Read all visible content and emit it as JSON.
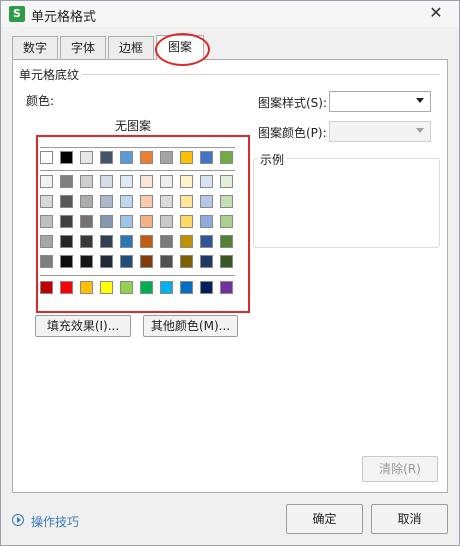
{
  "window": {
    "title": "单元格格式",
    "app_icon_text": "S",
    "close_label": "✕"
  },
  "tabs": [
    {
      "label": "数字"
    },
    {
      "label": "字体"
    },
    {
      "label": "边框"
    },
    {
      "label": "图案"
    }
  ],
  "active_tab": 3,
  "pattern": {
    "section_title": "单元格底纹",
    "color_label": "颜色:",
    "no_pattern_label": "无图案",
    "fill_effect_button": "填充效果(I)...",
    "more_colors_button": "其他颜色(M)...",
    "pattern_style_label": "图案样式(S):",
    "pattern_style_value": "",
    "pattern_color_label": "图案颜色(P):",
    "pattern_color_value": "",
    "sample_label": "示例",
    "clear_button": "清除(R)"
  },
  "palette": {
    "theme_top": [
      "#ffffff",
      "#000000",
      "#e7e6e6",
      "#44546a",
      "#5b9bd5",
      "#ed7d31",
      "#a5a5a5",
      "#ffc000",
      "#4472c4",
      "#70ad47"
    ],
    "theme_shades": [
      [
        "#f2f2f2",
        "#808080",
        "#d0cece",
        "#d6dce5",
        "#deebf7",
        "#fbe5d6",
        "#ededed",
        "#fff2cc",
        "#dae3f3",
        "#e2f0d9"
      ],
      [
        "#d9d9d9",
        "#595959",
        "#aeabab",
        "#adb9ca",
        "#bdd7ee",
        "#f8cbad",
        "#dbdbdb",
        "#ffe699",
        "#b4c7e7",
        "#c5e0b4"
      ],
      [
        "#bfbfbf",
        "#404040",
        "#757171",
        "#8497b0",
        "#9dc3e6",
        "#f4b183",
        "#c9c9c9",
        "#ffd966",
        "#8faadc",
        "#a9d18e"
      ],
      [
        "#a6a6a6",
        "#262626",
        "#3b3838",
        "#333f50",
        "#2e75b6",
        "#c55a11",
        "#7b7b7b",
        "#bf9000",
        "#2f5597",
        "#548235"
      ],
      [
        "#7f7f7f",
        "#0d0d0d",
        "#171616",
        "#222a35",
        "#1f4e79",
        "#843c0c",
        "#525252",
        "#7f6000",
        "#203864",
        "#385723"
      ]
    ],
    "standard": [
      "#c00000",
      "#ff0000",
      "#ffc000",
      "#ffff00",
      "#92d050",
      "#00b050",
      "#00b0f0",
      "#0070c0",
      "#002060",
      "#7030a0"
    ]
  },
  "footer": {
    "tips_label": "操作技巧",
    "ok_button": "确定",
    "cancel_button": "取消"
  },
  "colors": {
    "highlight_red": "#d92b2b",
    "link_blue": "#3a78c2"
  }
}
